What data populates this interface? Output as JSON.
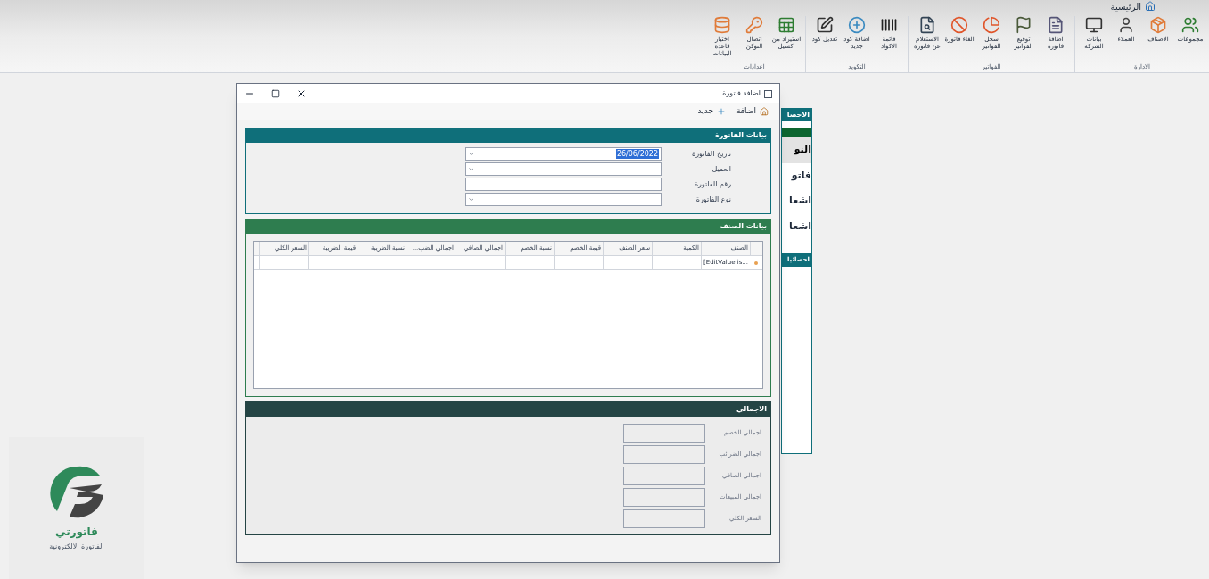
{
  "app": {
    "title": "الرئيسية"
  },
  "ribbon": {
    "groups": [
      {
        "label": "الادارة",
        "items": [
          {
            "label": "مجموعات",
            "kind": "groups"
          },
          {
            "label": "الاصناف",
            "kind": "products"
          },
          {
            "label": "العملاء",
            "kind": "customers"
          },
          {
            "label": "بيانات الشركه",
            "kind": "monitor"
          }
        ]
      },
      {
        "label": "الفواتير",
        "items": [
          {
            "label": "اضافة فاتورة",
            "kind": "add-invoice"
          },
          {
            "label": "توقيع الفواتير",
            "kind": "flag"
          },
          {
            "label": "سجل الفواتير",
            "kind": "chart"
          },
          {
            "label": "الغاء فاتورة",
            "kind": "cancel"
          },
          {
            "label": "الاستعلام عن فاتورة",
            "kind": "search-doc"
          }
        ]
      },
      {
        "label": "التكويد",
        "items": [
          {
            "label": "قائمة الاكواد",
            "kind": "barcode"
          },
          {
            "label": "اضافة كود جديد",
            "kind": "add-code"
          },
          {
            "label": "تعديل كود",
            "kind": "edit"
          }
        ]
      },
      {
        "label": "اعدادات",
        "items": [
          {
            "label": "استيراد من اكسيل",
            "kind": "excel"
          },
          {
            "label": "اتصال التوكن",
            "kind": "key"
          },
          {
            "label": "اختيار قاعدة البيانات",
            "kind": "database"
          }
        ]
      }
    ]
  },
  "background_panel": {
    "header": "الاحصا",
    "items": [
      {
        "label": "النو",
        "selected": true
      },
      {
        "label": "فاتو",
        "selected": false
      },
      {
        "label": "اشعا",
        "selected": false
      },
      {
        "label": "اشعا",
        "selected": false
      }
    ],
    "second_header": "احصائيا"
  },
  "dialog": {
    "title": "اضافة فاتورة",
    "toolbar": [
      {
        "label": "اضافة"
      },
      {
        "label": "جديد"
      }
    ],
    "invoice_section": {
      "title": "بيانات الفاتورة",
      "fields": [
        {
          "label": "تاريخ الفاتورة",
          "kind": "dropdown",
          "value": "26/06/2022",
          "value_selected": true
        },
        {
          "label": "العميل",
          "kind": "dropdown"
        },
        {
          "label": "رقم الفاتورة",
          "kind": "text"
        },
        {
          "label": "نوع الفاتورة",
          "kind": "dropdown"
        }
      ]
    },
    "items_section": {
      "title": "بيانات الصنف",
      "columns": [
        "الصنف",
        "الكمية",
        "سعر الصنف",
        "قيمة الخصم",
        "نسبة الخصم",
        "اجمالي الصافي",
        "اجمالي الضب...",
        "نسبة الضريبة",
        "قيمة الضريبة",
        "السعر الكلي"
      ],
      "new_row": {
        "first_cell": "[EditValue is..."
      }
    },
    "totals_section": {
      "title": "الاجمالي",
      "fields": [
        "اجمالي الخصم",
        "اجمالي الضرائب",
        "اجمالي الصافي",
        "اجمالي المبيعات",
        "السعر الكلي"
      ]
    }
  },
  "logo": {
    "name": "فاتورتي",
    "tagline": "الفاتورة الالكترونية"
  }
}
